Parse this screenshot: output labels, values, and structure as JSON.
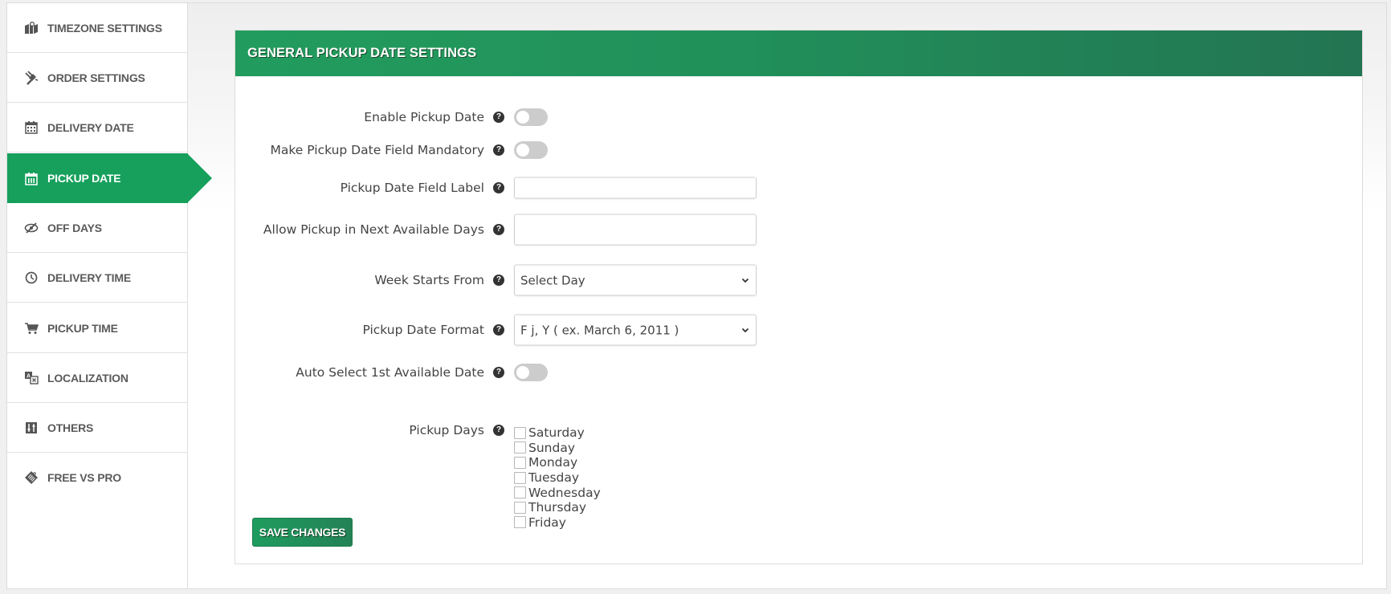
{
  "sidebar": {
    "items": [
      {
        "label": "TIMEZONE SETTINGS",
        "icon": "map-pin-icon",
        "active": false
      },
      {
        "label": "ORDER SETTINGS",
        "icon": "plug-icon",
        "active": false
      },
      {
        "label": "DELIVERY DATE",
        "icon": "calendar-icon",
        "active": false
      },
      {
        "label": "PICKUP DATE",
        "icon": "calendar-icon",
        "active": true
      },
      {
        "label": "OFF DAYS",
        "icon": "eye-slash-icon",
        "active": false
      },
      {
        "label": "DELIVERY TIME",
        "icon": "clock-icon",
        "active": false
      },
      {
        "label": "PICKUP TIME",
        "icon": "cart-icon",
        "active": false
      },
      {
        "label": "LOCALIZATION",
        "icon": "translate-icon",
        "active": false
      },
      {
        "label": "OTHERS",
        "icon": "sliders-icon",
        "active": false
      },
      {
        "label": "FREE VS PRO",
        "icon": "tag-icon",
        "active": false
      }
    ]
  },
  "panel": {
    "title": "GENERAL PICKUP DATE SETTINGS",
    "help_glyph": "?",
    "fields": {
      "enable_pickup_date": {
        "label": "Enable Pickup Date",
        "enabled": false
      },
      "mandatory": {
        "label": "Make Pickup Date Field Mandatory",
        "enabled": false
      },
      "field_label": {
        "label": "Pickup Date Field Label",
        "value": ""
      },
      "next_available_days": {
        "label": "Allow Pickup in Next Available Days",
        "value": ""
      },
      "week_starts_from": {
        "label": "Week Starts From",
        "selected": "Select Day"
      },
      "date_format": {
        "label": "Pickup Date Format",
        "selected": "F j, Y ( ex. March 6, 2011 )"
      },
      "auto_select_first": {
        "label": "Auto Select 1st Available Date",
        "enabled": false
      },
      "pickup_days": {
        "label": "Pickup Days",
        "days": [
          {
            "label": "Saturday",
            "checked": false
          },
          {
            "label": "Sunday",
            "checked": false
          },
          {
            "label": "Monday",
            "checked": false
          },
          {
            "label": "Tuesday",
            "checked": false
          },
          {
            "label": "Wednesday",
            "checked": false
          },
          {
            "label": "Thursday",
            "checked": false
          },
          {
            "label": "Friday",
            "checked": false
          }
        ]
      }
    },
    "save_label": "SAVE CHANGES"
  },
  "colors": {
    "accent": "#16a05c",
    "header_start": "#229c5e",
    "header_end": "#237452",
    "toggle_off": "#cccccc"
  }
}
